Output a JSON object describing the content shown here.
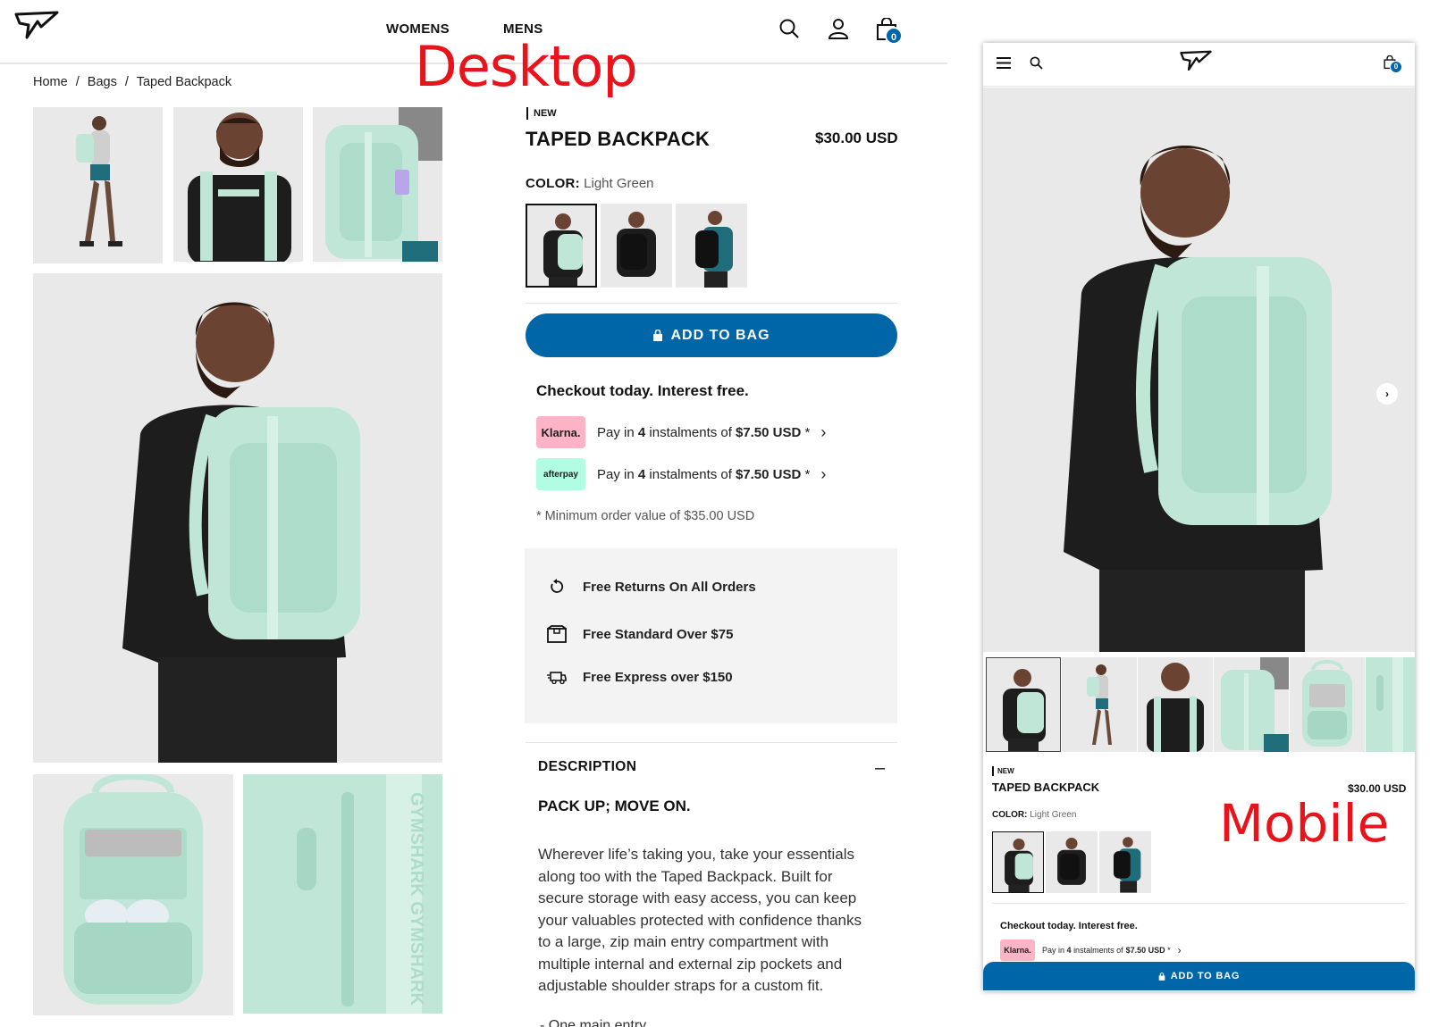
{
  "annotations": {
    "desktop": "Desktop",
    "mobile": "Mobile"
  },
  "nav": {
    "womens": "WOMENS",
    "mens": "MENS",
    "bag_count": "0"
  },
  "breadcrumb": [
    "Home",
    "/",
    "Bags",
    "/",
    "Taped Backpack"
  ],
  "product": {
    "badge": "NEW",
    "title": "TAPED BACKPACK",
    "price": "$30.00 USD",
    "color_label": "COLOR:",
    "color_value": "Light Green",
    "add_to_bag": "ADD TO BAG"
  },
  "checkout": {
    "heading": "Checkout today. Interest free.",
    "klarna_logo": "Klarna.",
    "afterpay_logo": "afterpay",
    "pay_prefix": "Pay in",
    "pay_count": "4",
    "pay_mid": "instalments of",
    "pay_amount": "$7.50 USD",
    "pay_suffix": "*",
    "minimum": "* Minimum order value of $35.00 USD"
  },
  "shipping": [
    {
      "icon": "returns-icon",
      "label": "Free Returns On All Orders"
    },
    {
      "icon": "box-icon",
      "label": "Free Standard Over $75"
    },
    {
      "icon": "truck-icon",
      "label": "Free Express over $150"
    }
  ],
  "description": {
    "heading": "DESCRIPTION",
    "toggle": "–",
    "subheading": "PACK UP; MOVE ON.",
    "body": "Wherever life’s taking you, take your essentials along too with the Taped Backpack. Built for secure storage with easy access, you can keep your valuables protected with confidence thanks to a large, zip main entry compartment with multiple internal and external zip pockets and adjustable shoulder straps for a custom fit.",
    "first_bullet": "- One main entry"
  },
  "colors": {
    "brand_blue": "#0066a8",
    "mint": "#bfe6d7",
    "klarna_pink": "#ffb3c7",
    "afterpay_mint": "#b2fce4",
    "annotation_red": "#e8141c"
  }
}
